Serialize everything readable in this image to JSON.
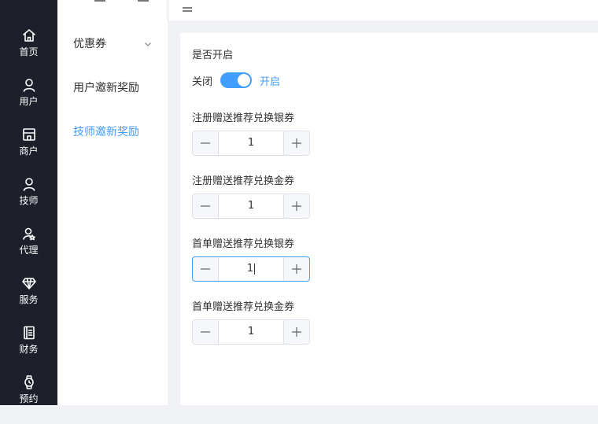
{
  "sidebar": {
    "items": [
      {
        "label": "首页",
        "icon": "home-icon"
      },
      {
        "label": "用户",
        "icon": "user-icon"
      },
      {
        "label": "商户",
        "icon": "store-icon"
      },
      {
        "label": "技师",
        "icon": "technician-icon"
      },
      {
        "label": "代理",
        "icon": "agent-icon"
      },
      {
        "label": "服务",
        "icon": "diamond-icon"
      },
      {
        "label": "财务",
        "icon": "ledger-icon"
      },
      {
        "label": "预约",
        "icon": "watch-icon"
      }
    ]
  },
  "submenu": {
    "items": [
      {
        "label": "优惠券"
      },
      {
        "label": "用户邀新奖励"
      },
      {
        "label": "技师邀新奖励"
      }
    ],
    "active_index": 2
  },
  "form": {
    "enable_label": "是否开启",
    "switch_off_text": "关闭",
    "switch_on_text": "开启",
    "switch_on": true,
    "fields": [
      {
        "label": "注册赠送推荐兑换银券",
        "value": "1"
      },
      {
        "label": "注册赠送推荐兑换金券",
        "value": "1"
      },
      {
        "label": "首单赠送推荐兑换银券",
        "value": "1"
      },
      {
        "label": "首单赠送推荐兑换金券",
        "value": "1"
      }
    ]
  },
  "colors": {
    "accent": "#409eff",
    "sidebar_bg": "#1d1f2b"
  }
}
